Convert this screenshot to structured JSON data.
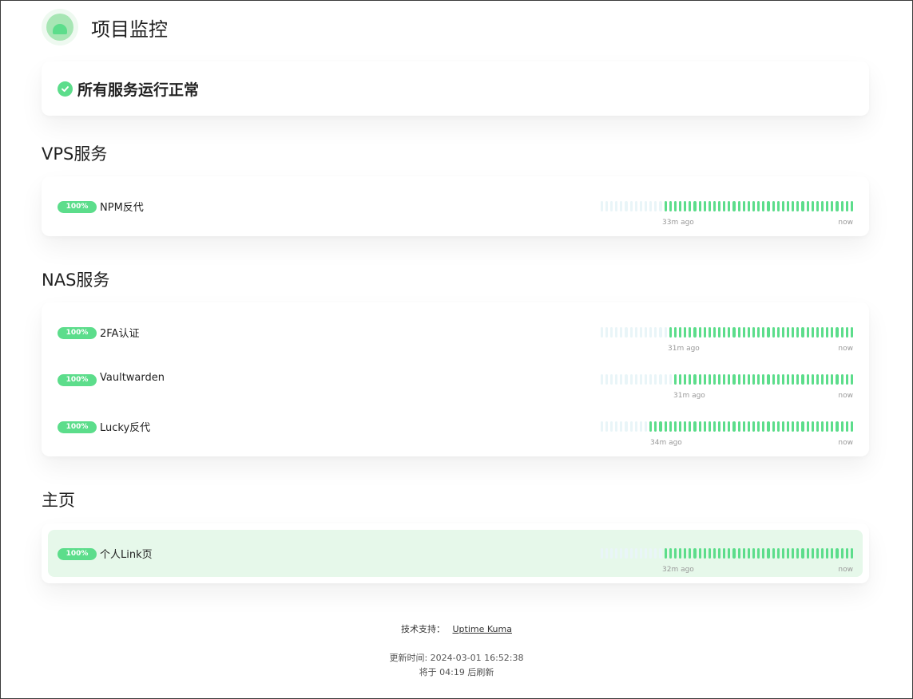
{
  "page": {
    "title": "项目监控",
    "overall_status": "所有服务运行正常",
    "colors": {
      "up": "#5cdd8b",
      "empty": "#e9f5f8",
      "highlight": "#e6f8ea"
    }
  },
  "groups": [
    {
      "title": "VPS服务",
      "monitors": [
        {
          "name": "NPM反代",
          "uptime": "100%",
          "empty_beats": 13,
          "up_beats": 39,
          "ago": "33m ago",
          "now": "now",
          "highlighted": false
        }
      ]
    },
    {
      "title": "NAS服务",
      "monitors": [
        {
          "name": "2FA认证",
          "uptime": "100%",
          "empty_beats": 14,
          "up_beats": 38,
          "ago": "31m ago",
          "now": "now",
          "highlighted": false
        },
        {
          "name": "Vaultwarden",
          "uptime": "100%",
          "empty_beats": 15,
          "up_beats": 37,
          "ago": "31m ago",
          "now": "now",
          "highlighted": false
        },
        {
          "name": "Lucky反代",
          "uptime": "100%",
          "empty_beats": 10,
          "up_beats": 42,
          "ago": "34m ago",
          "now": "now",
          "highlighted": false
        }
      ]
    },
    {
      "title": "主页",
      "monitors": [
        {
          "name": "个人Link页",
          "uptime": "100%",
          "empty_beats": 13,
          "up_beats": 39,
          "ago": "32m ago",
          "now": "now",
          "highlighted": true
        }
      ]
    }
  ],
  "footer": {
    "support_label": "技术支持：",
    "support_link": "Uptime Kuma",
    "updated": "更新时间: 2024-03-01 16:52:38",
    "refresh": "将于 04:19 后刷新"
  }
}
